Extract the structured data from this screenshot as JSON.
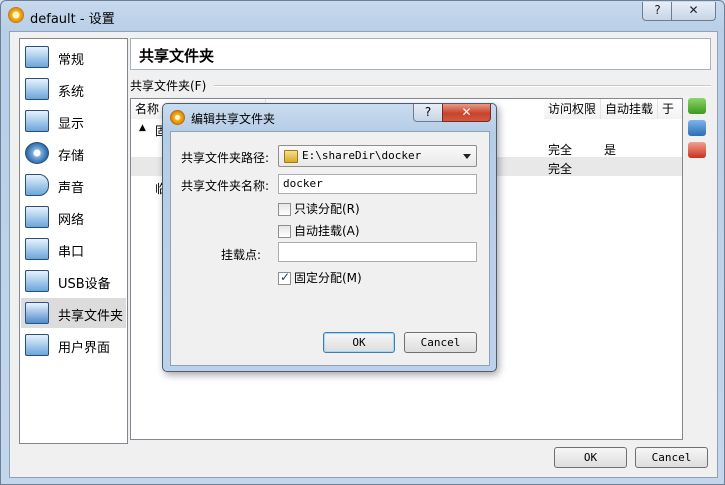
{
  "window": {
    "title": "default - 设置",
    "help_label": "?",
    "close_label": "✕"
  },
  "sidebar": {
    "items": [
      {
        "label": "常规",
        "icon": "monitor-icon"
      },
      {
        "label": "系统",
        "icon": "chip-icon"
      },
      {
        "label": "显示",
        "icon": "display-icon"
      },
      {
        "label": "存储",
        "icon": "disk-icon"
      },
      {
        "label": "声音",
        "icon": "speaker-icon"
      },
      {
        "label": "网络",
        "icon": "network-icon"
      },
      {
        "label": "串口",
        "icon": "serial-port-icon"
      },
      {
        "label": "USB设备",
        "icon": "usb-icon"
      },
      {
        "label": "共享文件夹",
        "icon": "shared-folder-icon"
      },
      {
        "label": "用户界面",
        "icon": "ui-window-icon"
      }
    ],
    "active_index": 8
  },
  "main": {
    "heading": "共享文件夹",
    "group_label": "共享文件夹(F)",
    "table": {
      "headers": [
        "名称",
        "访问权限",
        "自动挂载",
        "于"
      ],
      "rows": [
        {
          "name": "固",
          "access": "完全",
          "auto_mount": "是"
        },
        {
          "name": "临",
          "access": "完全",
          "auto_mount": ""
        }
      ]
    },
    "ok_label": "OK",
    "cancel_label": "Cancel"
  },
  "dialog": {
    "title": "编辑共享文件夹",
    "help_label": "?",
    "close_label": "✕",
    "path_label": "共享文件夹路径:",
    "path_value": "E:\\shareDir\\docker",
    "name_label": "共享文件夹名称:",
    "name_value": "docker",
    "readonly_label": "只读分配(R)",
    "readonly_checked": false,
    "automount_label": "自动挂载(A)",
    "automount_checked": false,
    "mountpoint_label": "挂载点:",
    "mountpoint_value": "",
    "permanent_label": "固定分配(M)",
    "permanent_checked": true,
    "ok_label": "OK",
    "cancel_label": "Cancel"
  }
}
